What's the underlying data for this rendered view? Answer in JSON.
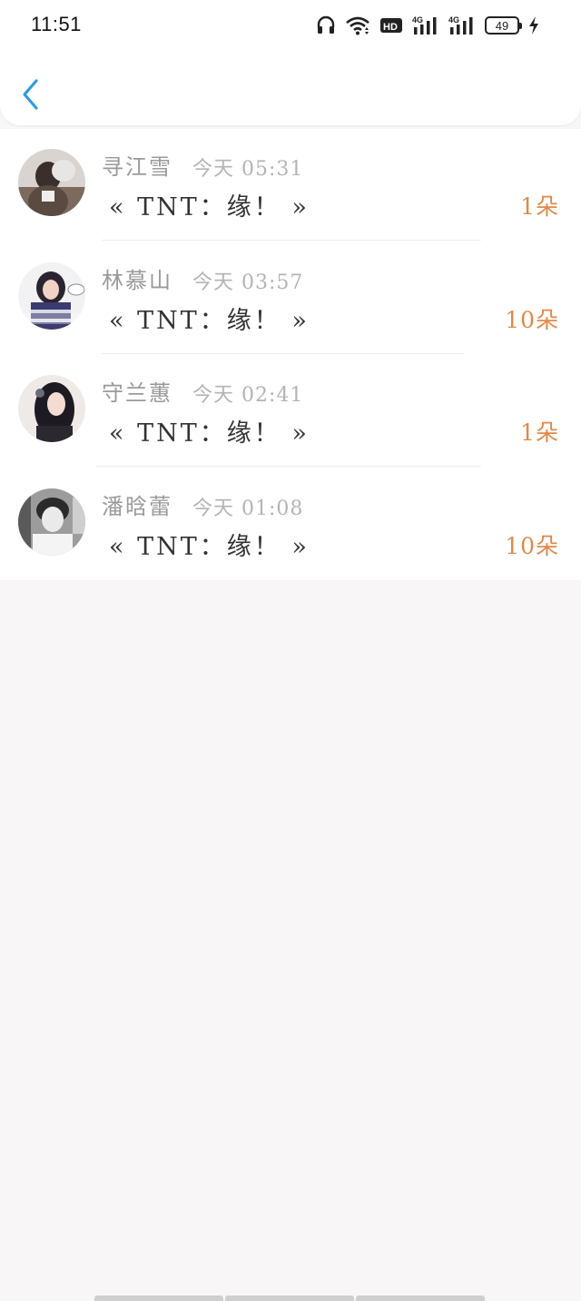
{
  "status_bar": {
    "time": "11:51",
    "battery_level": "49",
    "icons": [
      "headphones-icon",
      "wifi-icon",
      "hd-icon",
      "signal-4g-icon",
      "signal-4g-icon",
      "battery-icon",
      "charging-icon"
    ]
  },
  "nav": {
    "back_icon": "chevron-left-icon",
    "accent_color": "#2f9bdf"
  },
  "colors": {
    "count": "#e08a4a",
    "name": "#9a9a9a",
    "time": "#b4b4b4",
    "message": "#333333"
  },
  "items": [
    {
      "name": "寻江雪",
      "time": "今天 05:31",
      "message": "« TNT：缘！ »",
      "count": "1朵"
    },
    {
      "name": "林慕山",
      "time": "今天 03:57",
      "message": "« TNT：缘！ »",
      "count": "10朵"
    },
    {
      "name": "守兰蕙",
      "time": "今天 02:41",
      "message": "« TNT：缘！ »",
      "count": "1朵"
    },
    {
      "name": "潘晗蕾",
      "time": "今天 01:08",
      "message": "« TNT：缘！ »",
      "count": "10朵"
    }
  ]
}
